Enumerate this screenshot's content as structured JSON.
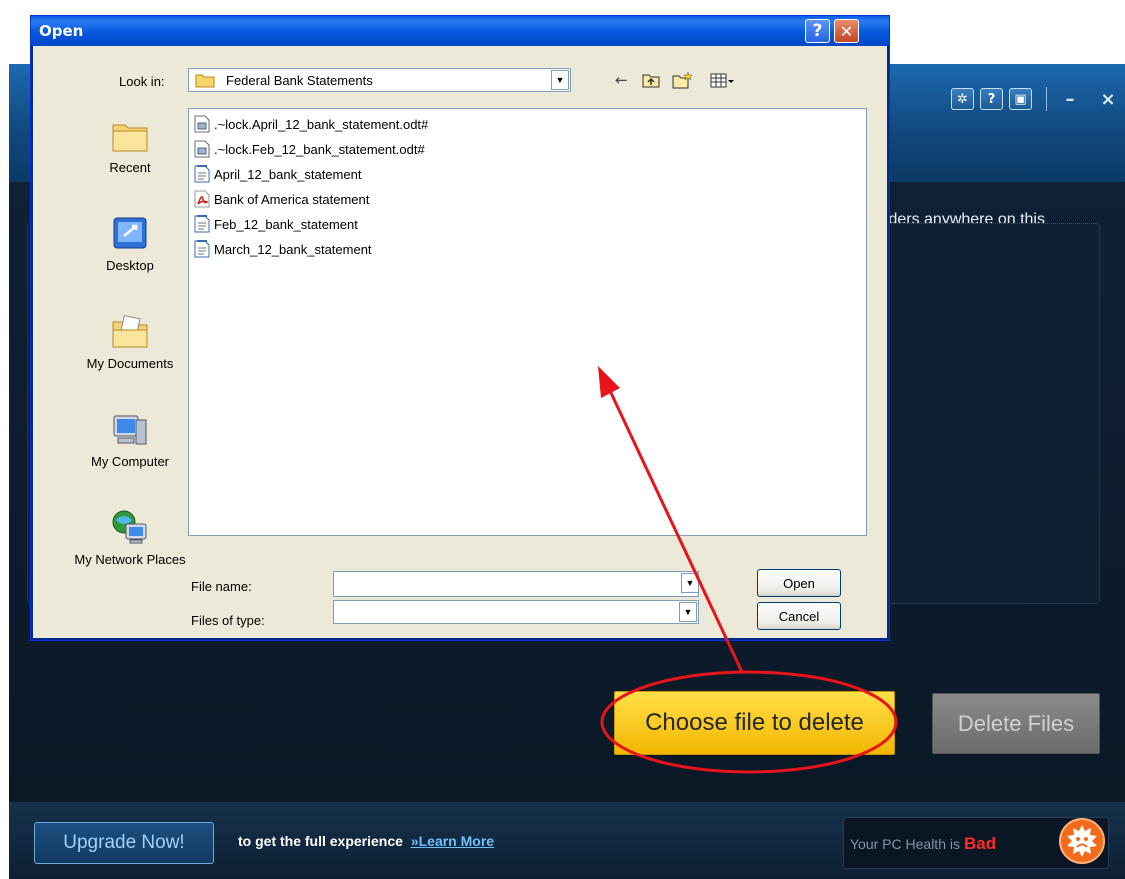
{
  "app": {
    "description_fragment": "olders anywhere on this",
    "choose_button": "Choose file to delete",
    "delete_button": "Delete Files",
    "upgrade_button": "Upgrade Now!",
    "footer_text": "to get the full experience",
    "learn_more": "»Learn More",
    "health_label": "Your PC Health is",
    "health_value": "Bad",
    "window_controls": [
      "gear-icon",
      "help-icon",
      "feedback-icon",
      "minimize-icon",
      "close-icon"
    ]
  },
  "dialog": {
    "title": "Open",
    "help_glyph": "?",
    "close_glyph": "✕",
    "look_in_label": "Look in:",
    "look_in_value": "Federal Bank Statements",
    "places": [
      {
        "label": "Recent",
        "icon": "recent-folder-icon"
      },
      {
        "label": "Desktop",
        "icon": "desktop-icon"
      },
      {
        "label": "My Documents",
        "icon": "my-documents-icon"
      },
      {
        "label": "My Computer",
        "icon": "my-computer-icon"
      },
      {
        "label": "My Network Places",
        "icon": "network-places-icon"
      }
    ],
    "files": [
      {
        "name": ".~lock.April_12_bank_statement.odt#",
        "icon": "lock-file-icon"
      },
      {
        "name": ".~lock.Feb_12_bank_statement.odt#",
        "icon": "lock-file-icon"
      },
      {
        "name": "April_12_bank_statement",
        "icon": "document-icon"
      },
      {
        "name": "Bank of America statement",
        "icon": "pdf-icon"
      },
      {
        "name": "Feb_12_bank_statement",
        "icon": "document-icon"
      },
      {
        "name": "March_12_bank_statement",
        "icon": "document-icon"
      }
    ],
    "file_name_label": "File name:",
    "file_name_value": "",
    "files_of_type_label": "Files of type:",
    "files_of_type_value": "",
    "open_button": "Open",
    "cancel_button": "Cancel"
  },
  "colors": {
    "xp_title_blue": "#0558dc",
    "choose_yellow": "#f2b600",
    "annotation_red": "#e8141b",
    "health_bad": "#ff2a2a"
  }
}
